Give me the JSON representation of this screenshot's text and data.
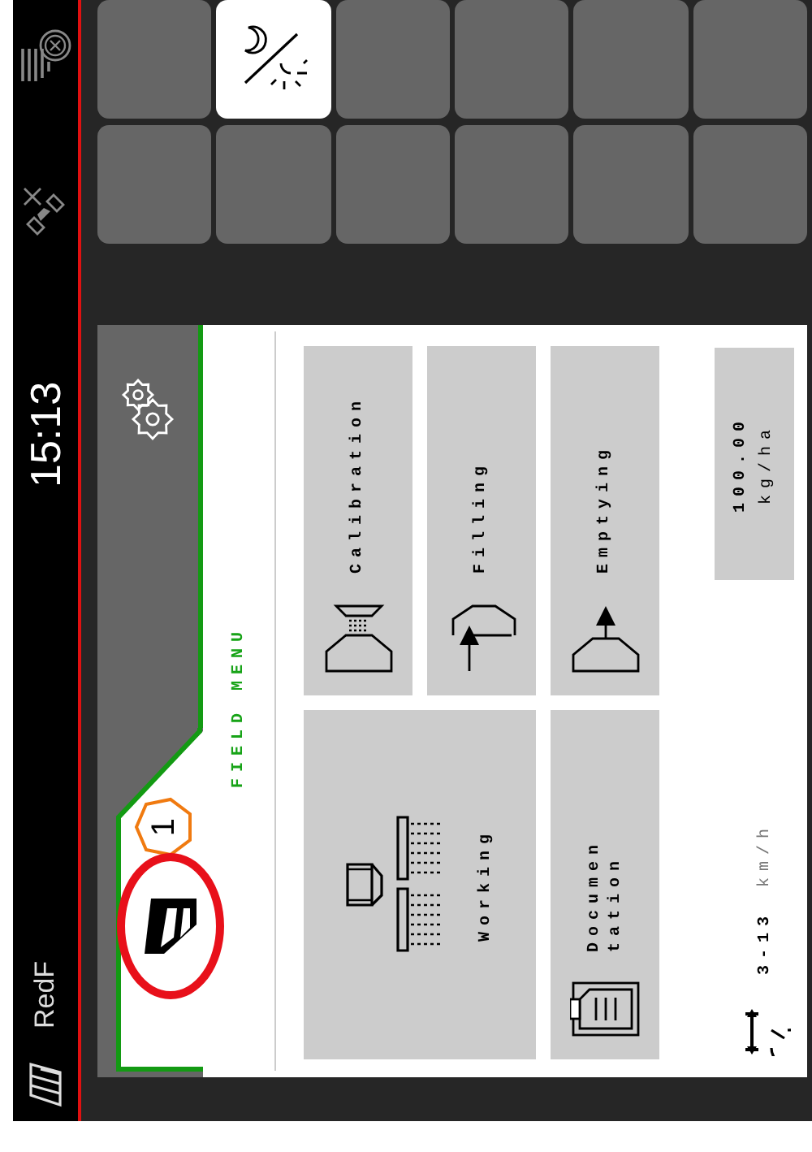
{
  "status_bar": {
    "field_name": "RedF",
    "time": "15:13"
  },
  "panel": {
    "badge": "1",
    "title": "FIELD MENU"
  },
  "menu_buttons": [
    {
      "kind": "working",
      "label_lines": [
        "Working"
      ]
    },
    {
      "kind": "calibration",
      "label_lines": [
        "Calibration"
      ]
    },
    {
      "kind": "filling",
      "label_lines": [
        "Filling"
      ]
    },
    {
      "kind": "documentation",
      "label_lines": [
        "Documen",
        "tation"
      ]
    },
    {
      "kind": "emptying",
      "label_lines": [
        "Emptying"
      ]
    }
  ],
  "rate": {
    "value": "100.00",
    "unit": "kg/ha"
  },
  "speed": {
    "range": "3-13",
    "unit": "km/h"
  },
  "tiles": [
    {
      "kind": "empty",
      "selected": false
    },
    {
      "kind": "empty",
      "selected": false
    },
    {
      "kind": "empty",
      "selected": false
    },
    {
      "kind": "day_night",
      "selected": true
    },
    {
      "kind": "empty",
      "selected": false
    },
    {
      "kind": "empty",
      "selected": false
    },
    {
      "kind": "empty",
      "selected": false
    },
    {
      "kind": "empty",
      "selected": false
    },
    {
      "kind": "empty",
      "selected": false
    },
    {
      "kind": "empty",
      "selected": false
    },
    {
      "kind": "empty",
      "selected": false
    },
    {
      "kind": "empty",
      "selected": false
    }
  ]
}
